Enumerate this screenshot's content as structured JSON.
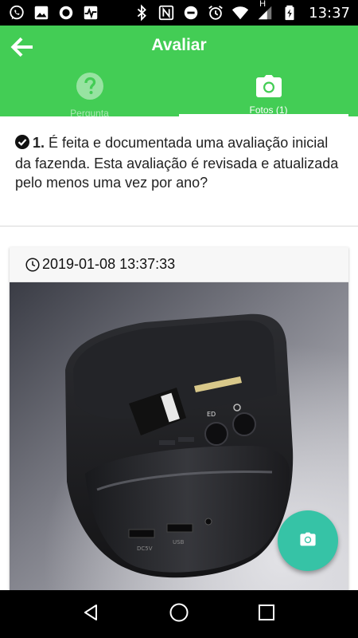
{
  "status_bar": {
    "time": "13:37",
    "left_icons": [
      "whatsapp-icon",
      "image-icon",
      "circle-icon",
      "pulse-icon"
    ],
    "right_icons": [
      "bluetooth-icon",
      "nfc-icon",
      "do-not-disturb-icon",
      "alarm-icon",
      "wifi-icon",
      "signal-icon",
      "battery-icon"
    ],
    "signal_label": "H"
  },
  "app_bar": {
    "title": "Avaliar",
    "back_icon": "arrow-left-icon",
    "color": "#43cd55"
  },
  "tabs": [
    {
      "label": "Pergunta",
      "icon": "help-circle-icon",
      "active": false
    },
    {
      "label": "Fotos (1)",
      "icon": "camera-icon",
      "active": true
    }
  ],
  "question": {
    "number": "1.",
    "text": "É feita e documentada uma avaliação inicial da fazenda. Esta avaliação é revisada e atualizada pelo menos uma vez por ano?",
    "status_icon": "check-circle-icon"
  },
  "photo_card": {
    "timestamp": "2019-01-08 13:37:33",
    "clock_icon": "clock-icon",
    "photo_subject": "black thermal receipt printer"
  },
  "fab": {
    "icon": "camera-icon",
    "color": "#36c3a6"
  },
  "nav_bar": {
    "buttons": [
      "back-triangle-icon",
      "home-circle-icon",
      "recents-square-icon"
    ]
  }
}
